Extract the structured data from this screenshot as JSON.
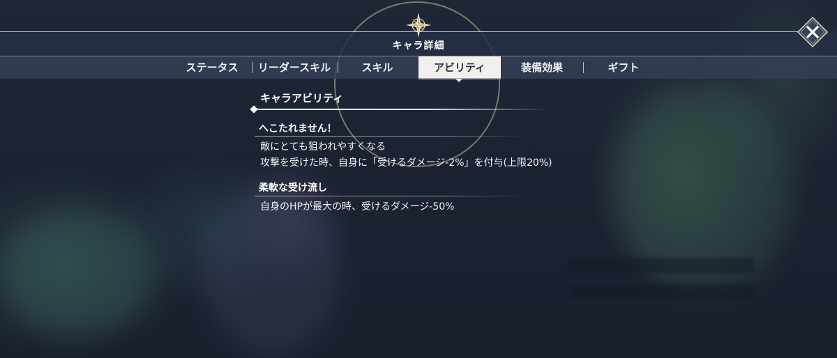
{
  "header": {
    "title": "キャラ詳細",
    "close_icon": "close-icon",
    "emblem_icon": "star-compass-icon"
  },
  "tabs": [
    {
      "label": "ステータス",
      "active": false
    },
    {
      "label": "リーダースキル",
      "active": false
    },
    {
      "label": "スキル",
      "active": false
    },
    {
      "label": "アビリティ",
      "active": true
    },
    {
      "label": "装備効果",
      "active": false
    },
    {
      "label": "ギフト",
      "active": false
    }
  ],
  "section": {
    "title": "キャラアビリティ"
  },
  "abilities": [
    {
      "name": "へこたれません！",
      "lines": [
        "敵にとても狙われやすくなる",
        "攻撃を受けた時、自身に「受けるダメージ-2%」を付与(上限20%)"
      ]
    },
    {
      "name": "柔軟な受け流し",
      "lines": [
        "自身のHPが最大の時、受けるダメージ-50%"
      ]
    }
  ],
  "colors": {
    "background": "#1f2636",
    "tab_active_bg": "#f1f0ec",
    "tab_active_text": "#2a3144",
    "text": "#ffffff",
    "accent_gold": "#e1d7b9"
  }
}
